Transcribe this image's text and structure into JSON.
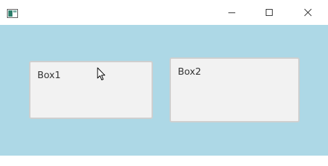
{
  "window": {
    "title": "",
    "controls": {
      "minimize_icon": "minimize-icon",
      "maximize_icon": "maximize-icon",
      "close_icon": "close-icon"
    }
  },
  "client": {
    "background": "#add8e6"
  },
  "boxes": [
    {
      "label": "Box1"
    },
    {
      "label": "Box2"
    }
  ],
  "cursor": {
    "icon": "arrow-cursor-icon"
  }
}
